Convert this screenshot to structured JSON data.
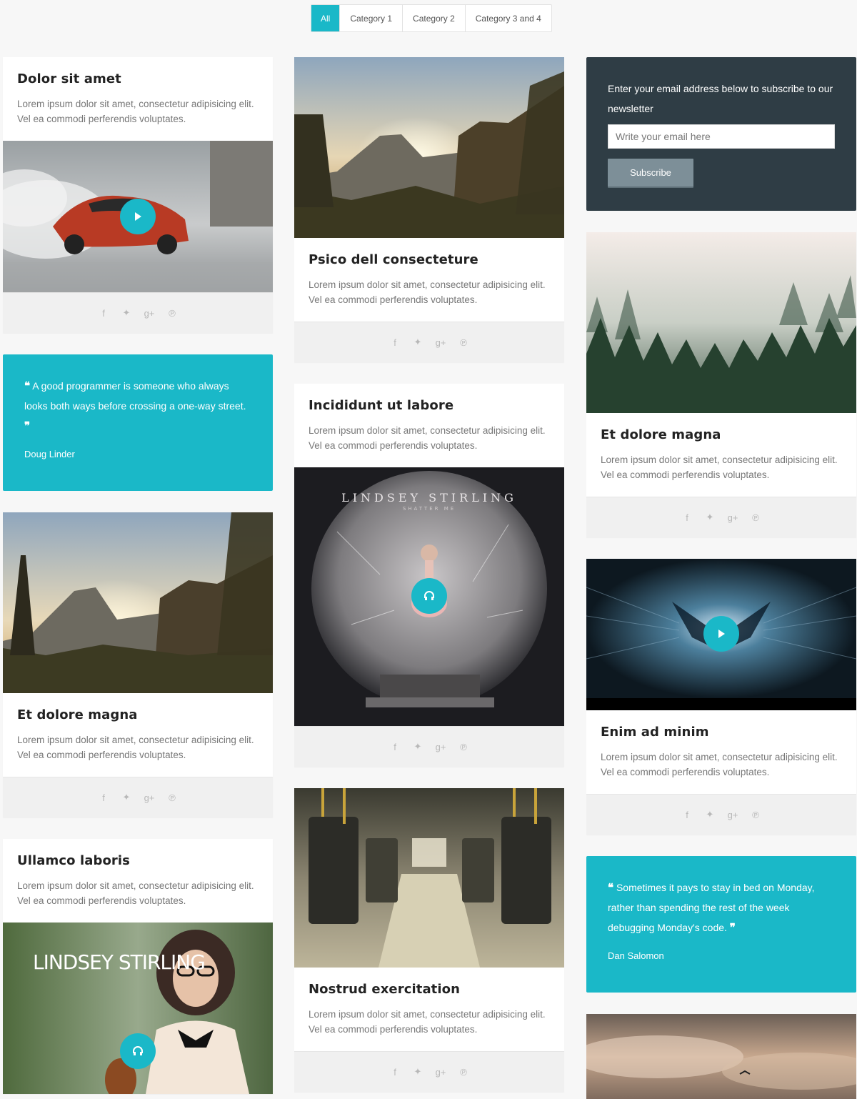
{
  "filters": [
    "All",
    "Category 1",
    "Category 2",
    "Category 3 and 4"
  ],
  "lorem": "Lorem ipsum dolor sit amet, consectetur adipisicing elit. Vel ea commodi perferendis voluptates.",
  "posts": {
    "dolor": {
      "title": "Dolor sit amet",
      "text": "Lorem ipsum dolor sit amet, consectetur adipisicing elit. Vel ea commodi perferendis voluptates."
    },
    "psico": {
      "title": "Psico dell consecteture",
      "text": "Lorem ipsum dolor sit amet, consectetur adipisicing elit. Vel ea commodi perferendis voluptates."
    },
    "etdolore1": {
      "title": "Et dolore magna",
      "text": "Lorem ipsum dolor sit amet, consectetur adipisicing elit. Vel ea commodi perferendis voluptates."
    },
    "incididunt": {
      "title": "Incididunt ut labore",
      "text": "Lorem ipsum dolor sit amet, consectetur adipisicing elit. Vel ea commodi perferendis voluptates."
    },
    "etdolore2": {
      "title": "Et dolore magna",
      "text": "Lorem ipsum dolor sit amet, consectetur adipisicing elit. Vel ea commodi perferendis voluptates."
    },
    "ullamco": {
      "title": "Ullamco laboris",
      "text": "Lorem ipsum dolor sit amet, consectetur adipisicing elit. Vel ea commodi perferendis voluptates."
    },
    "nostrud": {
      "title": "Nostrud exercitation",
      "text": "Lorem ipsum dolor sit amet, consectetur adipisicing elit. Vel ea commodi perferendis voluptates."
    },
    "enim": {
      "title": "Enim ad minim",
      "text": "Lorem ipsum dolor sit amet, consectetur adipisicing elit. Vel ea commodi perferendis voluptates."
    }
  },
  "album": {
    "artist": "LINDSEY STIRLING",
    "subtitle": "SHATTER ME"
  },
  "poster": {
    "artist": "LINDSEY STIRLING"
  },
  "quotes": {
    "q1": {
      "text": "A good programmer is someone who always looks both ways before crossing a one-way street.",
      "author": "Doug Linder"
    },
    "q2": {
      "text": "Sometimes it pays to stay in bed on Monday, rather than spending the rest of the week debugging Monday's code.",
      "author": "Dan Salomon"
    }
  },
  "newsletter": {
    "text": "Enter your email address below to subscribe to our newsletter",
    "placeholder": "Write your email here",
    "button": "Subscribe"
  },
  "social_icons": [
    "facebook-icon",
    "twitter-icon",
    "google-plus-icon",
    "pinterest-icon"
  ],
  "colors": {
    "accent": "#1ab8c8",
    "dark_panel": "#2f3d45",
    "button_gray": "#7d8f98"
  }
}
